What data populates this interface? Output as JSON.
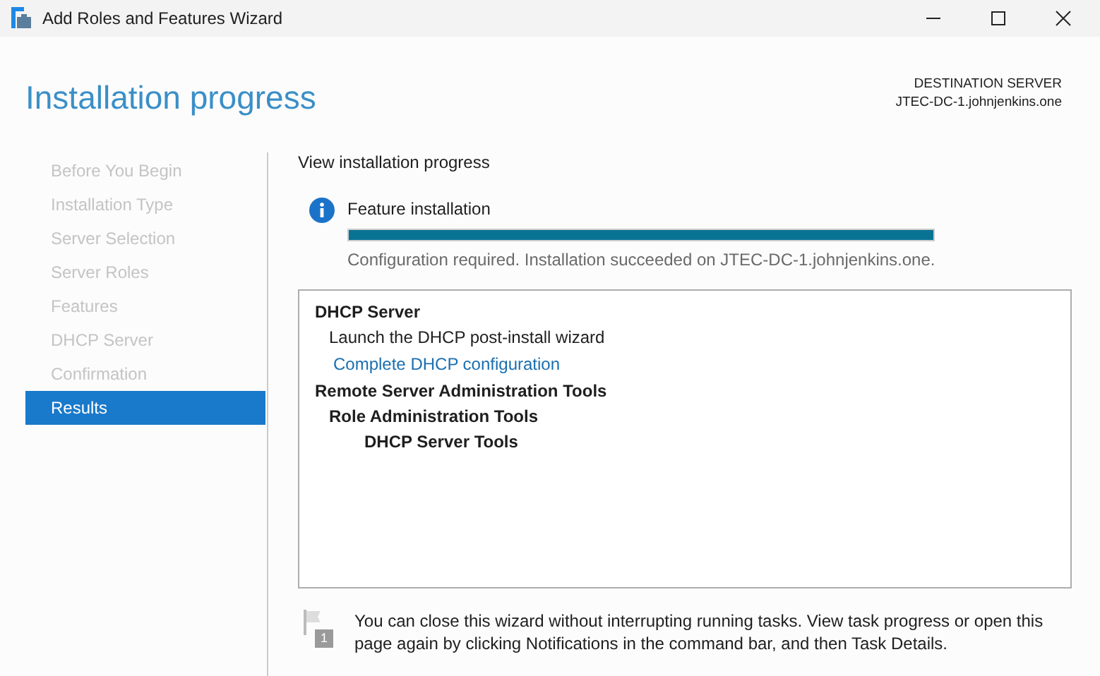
{
  "window": {
    "title": "Add Roles and Features Wizard"
  },
  "header": {
    "title": "Installation progress",
    "server_label": "DESTINATION SERVER",
    "server_name": "JTEC-DC-1.johnjenkins.one"
  },
  "sidebar": {
    "items": [
      {
        "label": "Before You Begin",
        "selected": false
      },
      {
        "label": "Installation Type",
        "selected": false
      },
      {
        "label": "Server Selection",
        "selected": false
      },
      {
        "label": "Server Roles",
        "selected": false
      },
      {
        "label": "Features",
        "selected": false
      },
      {
        "label": "DHCP Server",
        "selected": false
      },
      {
        "label": "Confirmation",
        "selected": false
      },
      {
        "label": "Results",
        "selected": true
      }
    ]
  },
  "content": {
    "heading": "View installation progress",
    "status": {
      "title": "Feature installation",
      "level": 1.0,
      "message": "Configuration required. Installation succeeded on JTEC-DC-1.johnjenkins.one."
    },
    "results": [
      {
        "kind": "heading",
        "label": "DHCP Server",
        "children": [
          {
            "kind": "text",
            "label": "Launch the DHCP post-install wizard"
          },
          {
            "kind": "link",
            "label": "Complete DHCP configuration"
          }
        ]
      },
      {
        "kind": "heading",
        "label": "Remote Server Administration Tools",
        "children": [
          {
            "kind": "heading",
            "label": "Role Administration Tools",
            "children": [
              {
                "kind": "heading",
                "label": "DHCP Server Tools"
              }
            ]
          }
        ]
      }
    ],
    "note": {
      "badge": "1",
      "text": "You can close this wizard without interrupting running tasks. View task progress or open this page again by clicking Notifications in the command bar, and then Task Details."
    }
  }
}
